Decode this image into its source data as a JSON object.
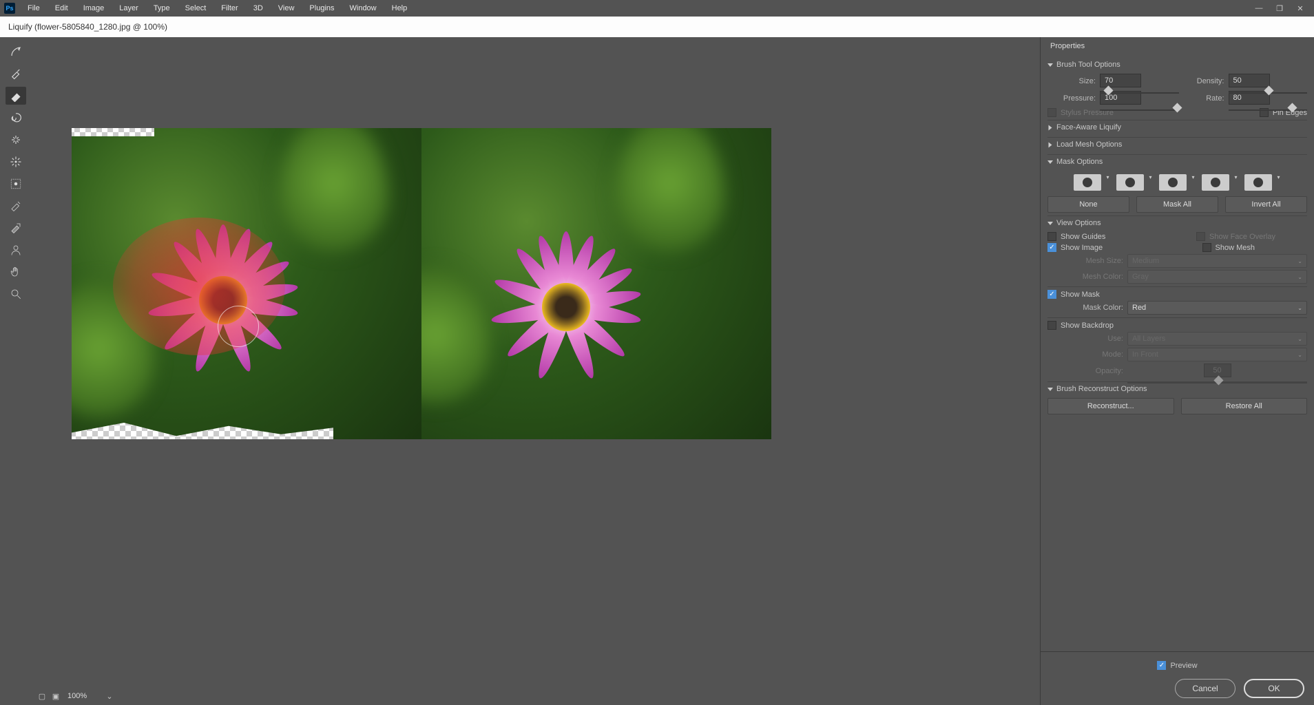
{
  "menubar": [
    "File",
    "Edit",
    "Image",
    "Layer",
    "Type",
    "Select",
    "Filter",
    "3D",
    "View",
    "Plugins",
    "Window",
    "Help"
  ],
  "title": "Liquify (flower-5805840_1280.jpg @ 100%)",
  "tools": [
    {
      "name": "forward-warp-icon"
    },
    {
      "name": "reconstruct-icon"
    },
    {
      "name": "smooth-icon",
      "sel": true
    },
    {
      "name": "twirl-icon"
    },
    {
      "name": "pucker-icon"
    },
    {
      "name": "bloat-icon"
    },
    {
      "name": "push-left-icon"
    },
    {
      "name": "freeze-mask-icon"
    },
    {
      "name": "thaw-mask-icon"
    },
    {
      "name": "face-icon"
    },
    {
      "name": "hand-icon"
    },
    {
      "name": "zoom-icon"
    }
  ],
  "zoom": {
    "value": "100%"
  },
  "panel": {
    "title": "Properties",
    "brush": {
      "title": "Brush Tool Options",
      "size_lbl": "Size:",
      "size": "70",
      "density_lbl": "Density:",
      "density": "50",
      "pressure_lbl": "Pressure:",
      "pressure": "100",
      "rate_lbl": "Rate:",
      "rate": "80",
      "stylus": "Stylus Pressure",
      "pin": "Pin Edges"
    },
    "face": {
      "title": "Face-Aware Liquify"
    },
    "loadmesh": {
      "title": "Load Mesh Options"
    },
    "mask": {
      "title": "Mask Options",
      "none": "None",
      "maskall": "Mask All",
      "invert": "Invert All"
    },
    "view": {
      "title": "View Options",
      "show_guides": "Show Guides",
      "show_face": "Show Face Overlay",
      "show_image": "Show Image",
      "show_mesh": "Show Mesh",
      "mesh_size_lbl": "Mesh Size:",
      "mesh_size": "Medium",
      "mesh_color_lbl": "Mesh Color:",
      "mesh_color": "Gray",
      "show_mask": "Show Mask",
      "mask_color_lbl": "Mask Color:",
      "mask_color": "Red",
      "show_backdrop": "Show Backdrop",
      "use_lbl": "Use:",
      "use": "All Layers",
      "mode_lbl": "Mode:",
      "mode": "In Front",
      "opacity_lbl": "Opacity:",
      "opacity": "50"
    },
    "recon": {
      "title": "Brush Reconstruct Options",
      "reconstruct": "Reconstruct...",
      "restore": "Restore All"
    }
  },
  "footer": {
    "preview": "Preview",
    "cancel": "Cancel",
    "ok": "OK"
  }
}
